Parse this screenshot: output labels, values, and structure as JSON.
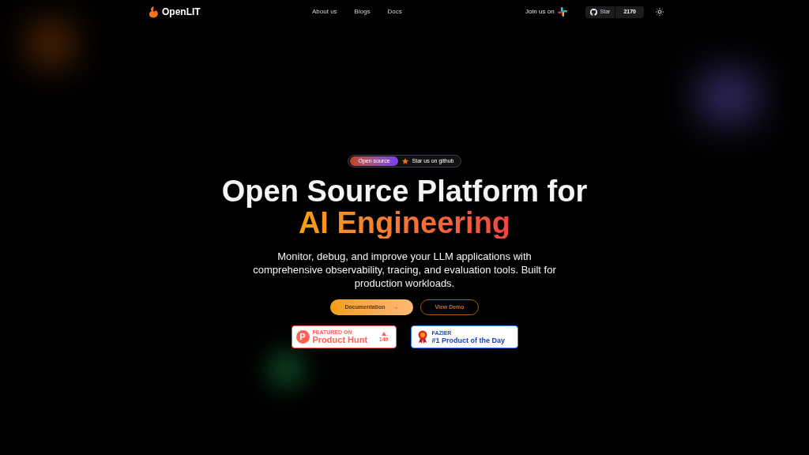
{
  "nav": {
    "brand": "OpenLIT",
    "links": [
      "About us",
      "Blogs",
      "Docs"
    ],
    "join": "Join us on",
    "star": {
      "label": "Star",
      "count": "2170"
    }
  },
  "hero": {
    "badge": {
      "tag": "Open source",
      "text": "Star us on github"
    },
    "title": "Open Source Platform for",
    "highlight": "AI Engineering",
    "subtitle": "Monitor, debug, and improve your LLM applications with comprehensive observability, tracing, and evaluation tools. Built for production workloads.",
    "buttons": [
      {
        "label": "Documentation",
        "kind": "primary",
        "arrow": "→"
      },
      {
        "label": "View Demo",
        "kind": "outline"
      }
    ],
    "awards": [
      {
        "kind": "producthunt",
        "logo": "P",
        "caption": "FEATURED ON",
        "name": "Product Hunt",
        "count": "149"
      },
      {
        "kind": "fazier",
        "caption": "FAZIER",
        "name": "#1 Product of the Day"
      }
    ]
  }
}
